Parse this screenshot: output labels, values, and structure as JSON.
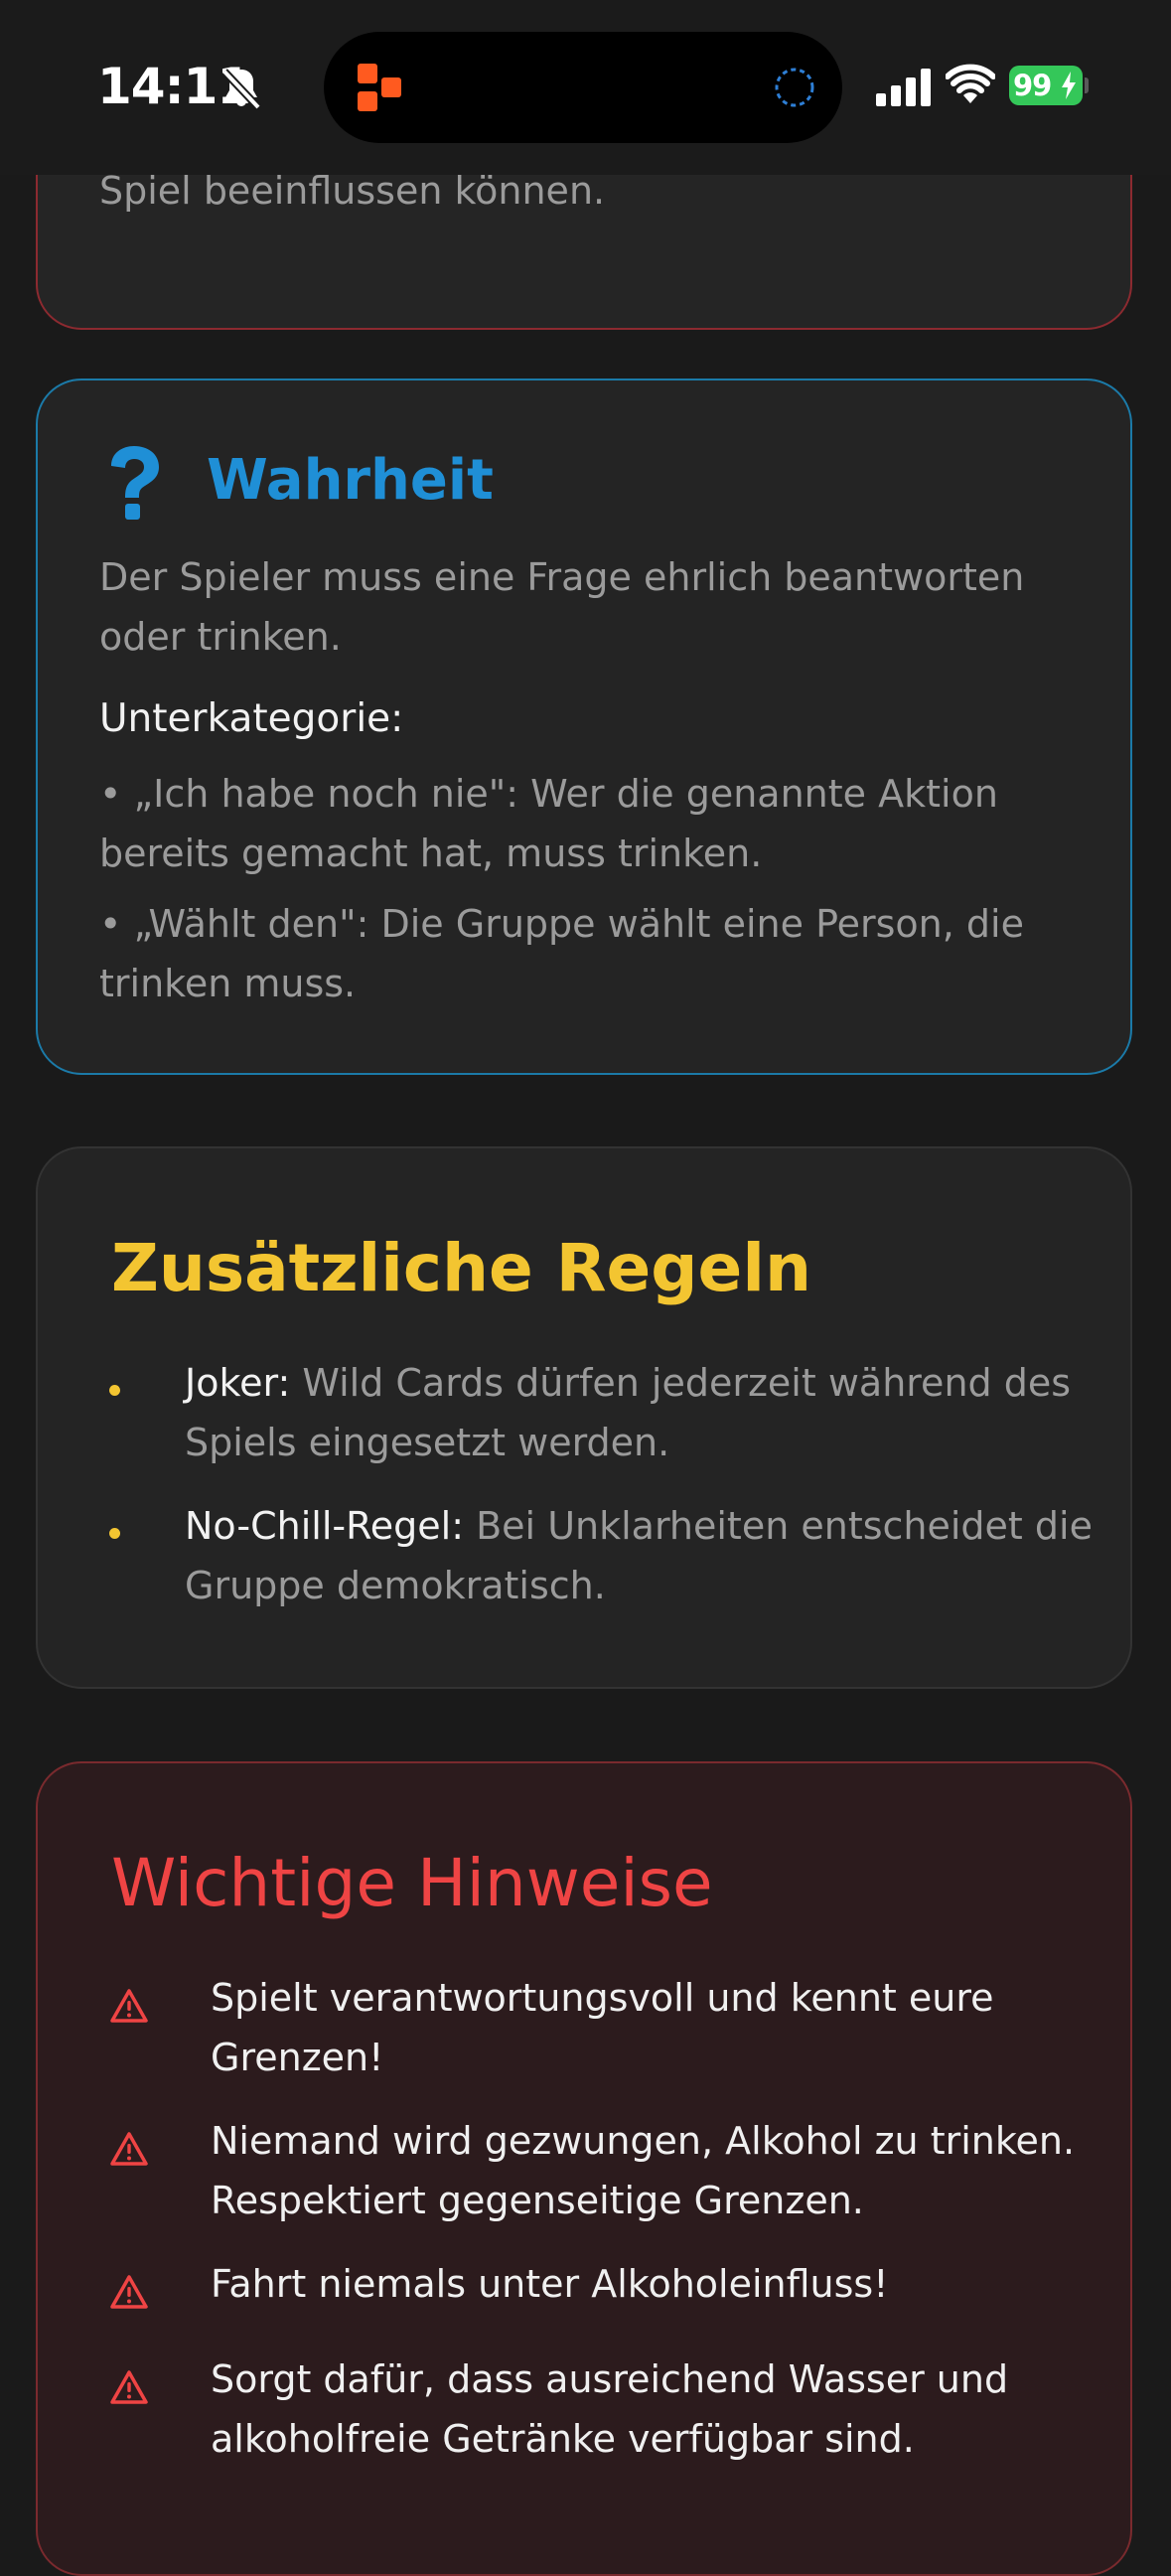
{
  "status_bar": {
    "time": "14:11",
    "battery": "99"
  },
  "special_card": {
    "text": "Spezialkarten mit einzigartigen Effekten, die das Spiel beeinflussen können."
  },
  "wahrheit_card": {
    "title": "Wahrheit",
    "description": "Der Spieler muss eine Frage ehrlich beantworten oder trinken.",
    "sub_label": "Unterkategorie:",
    "sub_items": [
      "• „Ich habe noch nie\": Wer die genannte Aktion bereits gemacht hat, muss trinken.",
      "• „Wählt den\": Die Gruppe wählt eine Person, die trinken muss."
    ]
  },
  "rules_card": {
    "title": "Zusätzliche Regeln",
    "rules": [
      {
        "name": "Joker:",
        "text": " Wild Cards dürfen jederzeit während des Spiels eingesetzt werden."
      },
      {
        "name": "No-Chill-Regel:",
        "text": " Bei Unklarheiten entscheidet die Gruppe demokratisch."
      }
    ]
  },
  "warn_card": {
    "title": "Wichtige Hinweise",
    "items": [
      "Spielt verantwortungsvoll und kennt eure Grenzen!",
      "Niemand wird gezwungen, Alkohol zu trinken. Respektiert gegenseitige Grenzen.",
      "Fahrt niemals unter Alkoholeinfluss!",
      "Sorgt dafür, dass ausreichend Wasser und alkoholfreie Getränke verfügbar sind."
    ]
  },
  "colors": {
    "background": "#1a1a1a",
    "card": "#242424",
    "wahrheit_accent": "#1f8fd6",
    "rules_accent": "#f3c531",
    "warn_accent": "#ef4444",
    "battery_green": "#34c759"
  },
  "icons": {
    "bell": "bell-slash-icon",
    "question": "question-mark-icon",
    "warning": "warning-triangle-icon",
    "signal": "cellular-signal-icon",
    "wifi": "wifi-icon"
  }
}
